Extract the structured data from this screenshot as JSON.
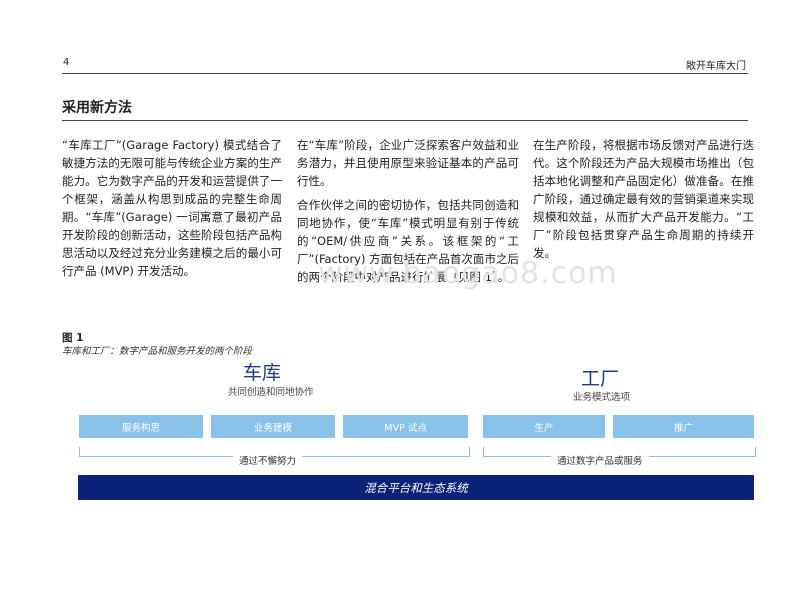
{
  "header": {
    "page_number": "4",
    "running_title": "敞开车库大门"
  },
  "section": {
    "title": "采用新方法"
  },
  "columns": {
    "col1": [
      "“车库工厂”(Garage Factory) 模式结合了敏捷方法的无限可能与传统企业方案的生产能力。它为数字产品的开发和运营提供了一个框架，涵盖从构思到成品的完整生命周期。“车库”(Garage) 一词寓意了最初产品开发阶段的创新活动，这些阶段包括产品构思活动以及经过充分业务建模之后的最小可行产品 (MVP) 开发活动。"
    ],
    "col2": [
      "在“车库”阶段，企业广泛探索客户效益和业务潜力，并且使用原型来验证基本的产品可行性。",
      "合作伙伴之间的密切协作，包括共同创造和同地协作，使“车库”模式明显有别于传统的“OEM/供应商”关系。该框架的“工厂”(Factory) 方面包括在产品首次面市之后的两个阶段中对产品进行扩展（见图 1）。"
    ],
    "col3": [
      "在生产阶段，将根据市场反馈对产品进行迭代。这个阶段还为产品大规模市场推出（包括本地化调整和产品固定化）做准备。在推广阶段，通过确定最有效的营销渠道来实现规模和效益，从而扩大产品开发能力。“工厂”阶段包括贯穿产品生命周期的持续开发。"
    ]
  },
  "watermark": "www.baogao8.com",
  "figure": {
    "label": "图 1",
    "caption": "车库和工厂：数字产品和服务开发的两个阶段",
    "garage": {
      "title": "车库",
      "subtitle": "共同创造和同地协作"
    },
    "factory": {
      "title": "工厂",
      "subtitle": "业务模式选项"
    },
    "steps": [
      "服务构思",
      "业务建模",
      "MVP 试点",
      "生产",
      "推广"
    ],
    "garage_bracket_label": "通过不懈努力",
    "factory_bracket_label": "通过数字产品或服务",
    "platform_label": "混合平台和生态系统",
    "colors": {
      "step_box": "#88c2e8",
      "platform_bar": "#0c2278",
      "phase_title": "#1d3c87"
    }
  }
}
